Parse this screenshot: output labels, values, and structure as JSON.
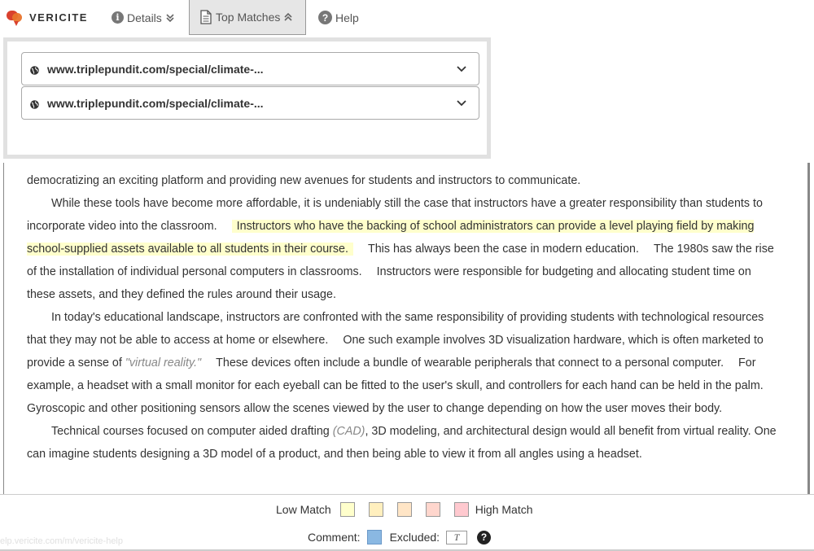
{
  "brand": {
    "name": "VERICITE"
  },
  "nav": {
    "details_label": "Details",
    "top_matches_label": "Top Matches",
    "help_label": "Help"
  },
  "matches": [
    {
      "url": "www.triplepundit.com/special/climate-..."
    },
    {
      "url": "www.triplepundit.com/special/climate-..."
    }
  ],
  "document": {
    "line0": "democratizing an exciting platform and providing new avenues for students and instructors to communicate.",
    "p1_a": "While these tools have become more affordable, it is undeniably still the case that instructors have a greater responsibility than students to incorporate video into the classroom.",
    "p1_hl": "Instructors who have the backing of school administrators can provide a level playing field by making school-supplied assets available to all students in their course.",
    "p1_b": "This has always been the case in modern education.",
    "p1_c": "The 1980s saw the rise of the installation of individual personal computers in classrooms.",
    "p1_d": "Instructors were responsible for budgeting and allocating student time on these assets, and they defined the rules around their usage.",
    "p2_a": "In today's educational landscape, instructors are confronted with the same responsibility of providing students with technological resources that they may not be able to access at home or elsewhere.",
    "p2_b": "One such example involves 3D visualization hardware, which is often marketed to provide a sense of",
    "p2_quote": "\"virtual reality.\"",
    "p2_c": "These devices often include a bundle of wearable peripherals that connect to a personal computer.",
    "p2_d": "For example, a headset with a small monitor for each eyeball can be fitted to the user's skull, and controllers for each hand can be held in the palm.",
    "p2_e": "Gyroscopic and other positioning sensors allow the scenes viewed by the user to change depending on how the user moves their body.",
    "p3_a": "Technical courses focused on computer aided drafting",
    "p3_cad": "(CAD)",
    "p3_b": ", 3D modeling, and architectural design would all benefit from virtual reality.",
    "p3_c": "One can imagine students designing a 3D model of a product, and then being able to view it from all angles using a headset."
  },
  "legend": {
    "low_label": "Low Match",
    "high_label": "High Match",
    "comment_label": "Comment:",
    "excluded_label": "Excluded:",
    "excluded_symbol": "T",
    "colors": [
      "#ffffcc",
      "#ffefbe",
      "#ffe5c6",
      "#ffd6cd",
      "#ffc9cf"
    ],
    "comment_color": "#8ab8e2"
  },
  "status_bar": {
    "url": "elp.vericite.com/m/vericite-help"
  },
  "icons": {
    "details": "info-icon",
    "top_matches": "document-icon",
    "help": "question-icon",
    "match": "globe-icon"
  }
}
